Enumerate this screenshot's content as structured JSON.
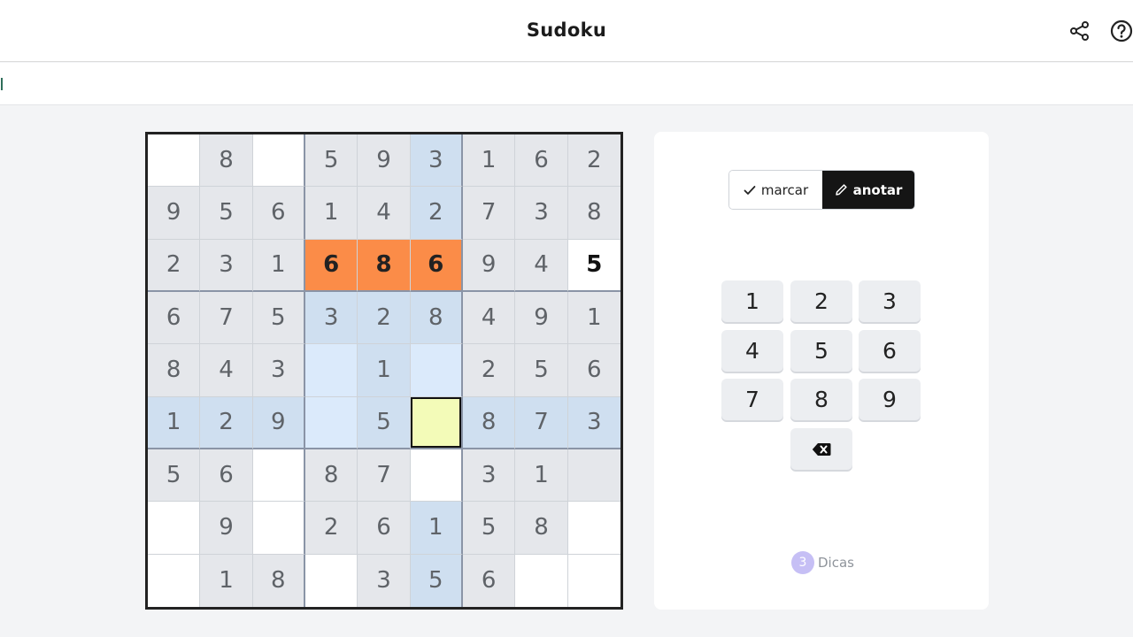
{
  "header": {
    "title": "Sudoku",
    "share_icon": "share-icon",
    "help_icon": "help-icon"
  },
  "board": {
    "rows": [
      [
        "",
        "8",
        "",
        "5",
        "9",
        "3",
        "1",
        "6",
        "2"
      ],
      [
        "9",
        "5",
        "6",
        "1",
        "4",
        "2",
        "7",
        "3",
        "8"
      ],
      [
        "2",
        "3",
        "1",
        "6",
        "8",
        "6",
        "9",
        "4",
        "5"
      ],
      [
        "6",
        "7",
        "5",
        "3",
        "2",
        "8",
        "4",
        "9",
        "1"
      ],
      [
        "8",
        "4",
        "3",
        "",
        "1",
        "",
        "2",
        "5",
        "6"
      ],
      [
        "1",
        "2",
        "9",
        "",
        "5",
        "",
        "8",
        "7",
        "3"
      ],
      [
        "5",
        "6",
        "",
        "8",
        "7",
        "",
        "3",
        "1",
        ""
      ],
      [
        "",
        "9",
        "",
        "2",
        "6",
        "1",
        "5",
        "8",
        ""
      ],
      [
        "",
        "1",
        "8",
        "",
        "3",
        "5",
        "6",
        "",
        ""
      ]
    ],
    "shading": [
      "wgwggbggg",
      "gggggbggg",
      "ggggogggw",
      "gggbbbggg",
      "ggglblggg",
      "bbblbsbbb",
      "ggwggwgggw",
      "wgwggbggw",
      "wggwgbgww"
    ],
    "conflict_cells": [
      [
        2,
        3
      ],
      [
        2,
        5
      ]
    ],
    "bold_cells": [
      [
        2,
        8
      ]
    ],
    "selected_cell": [
      5,
      5
    ],
    "colors": {
      "conflict": "#fb8c48",
      "selected": "#f3fbb8",
      "highlight": "#cfdff0",
      "highlight_light": "#dbeafb",
      "given": "#e5e7eb"
    }
  },
  "controls": {
    "mode_mark_label": "marcar",
    "mode_note_label": "anotar",
    "active_mode": "anotar",
    "keys": [
      "1",
      "2",
      "3",
      "4",
      "5",
      "6",
      "7",
      "8",
      "9"
    ],
    "erase_icon": "backspace-icon",
    "hints_count": "3",
    "hints_label": "Dicas"
  }
}
